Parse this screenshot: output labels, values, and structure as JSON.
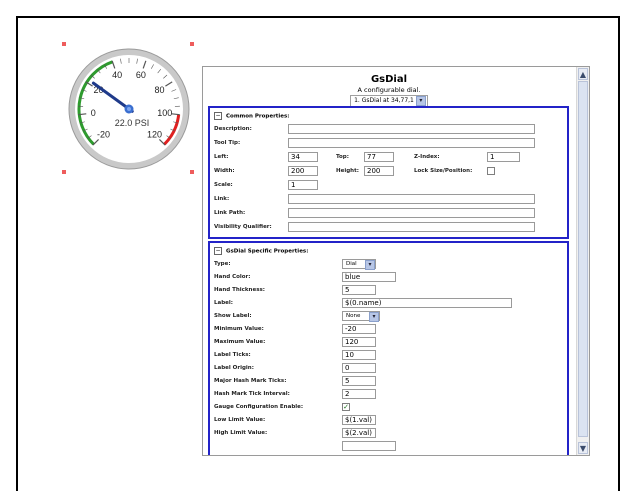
{
  "gauge": {
    "ticks": [
      "-20",
      "0",
      "20",
      "40",
      "60",
      "80",
      "100",
      "120"
    ],
    "readout": "22.0 PSI",
    "value": 22,
    "min": -20,
    "max": 120,
    "hand_color": "#1f3a8a",
    "low_zone_color": "#2e9b2e",
    "high_zone_color": "#e02020"
  },
  "panel": {
    "title": "GsDial",
    "subtitle": "A configurable dial.",
    "selector": "1. GsDial at 34,77,1",
    "common": {
      "title": "Common Properties:",
      "description_label": "Description:",
      "description_value": "",
      "tooltip_label": "Tool Tip:",
      "tooltip_value": "",
      "left_label": "Left:",
      "left_value": "34",
      "top_label": "Top:",
      "top_value": "77",
      "zindex_label": "Z-Index:",
      "zindex_value": "1",
      "width_label": "Width:",
      "width_value": "200",
      "height_label": "Height:",
      "height_value": "200",
      "lock_label": "Lock Size/Position:",
      "scale_label": "Scale:",
      "scale_value": "1",
      "link_label": "Link:",
      "link_value": "",
      "linkpath_label": "Link Path:",
      "linkpath_value": "",
      "visibility_label": "Visibility Qualifier:",
      "visibility_value": ""
    },
    "specific": {
      "title": "GsDial Specific Properties:",
      "type_label": "Type:",
      "type_value": "Dial",
      "handcolor_label": "Hand Color:",
      "handcolor_value": "blue",
      "handthick_label": "Hand Thickness:",
      "handthick_value": "5",
      "label_label": "Label:",
      "label_value": "$(0.name)",
      "showlabel_label": "Show Label:",
      "showlabel_value": "None",
      "min_label": "Minimum Value:",
      "min_value": "-20",
      "max_label": "Maximum Value:",
      "max_value": "120",
      "labelticks_label": "Label Ticks:",
      "labelticks_value": "10",
      "labelorigin_label": "Label Origin:",
      "labelorigin_value": "0",
      "majorhash_label": "Major Hash Mark Ticks:",
      "majorhash_value": "5",
      "hashinterval_label": "Hash Mark Tick Interval:",
      "hashinterval_value": "2",
      "gaugeconfig_label": "Gauge Configuration Enable:",
      "lowlimit_label": "Low Limit Value:",
      "lowlimit_value": "$(1.val)",
      "highlimit_label": "High Limit Value:",
      "highlimit_value": "$(2.val)"
    },
    "checkmark": "✓",
    "dropdown_arrow": "▾"
  }
}
